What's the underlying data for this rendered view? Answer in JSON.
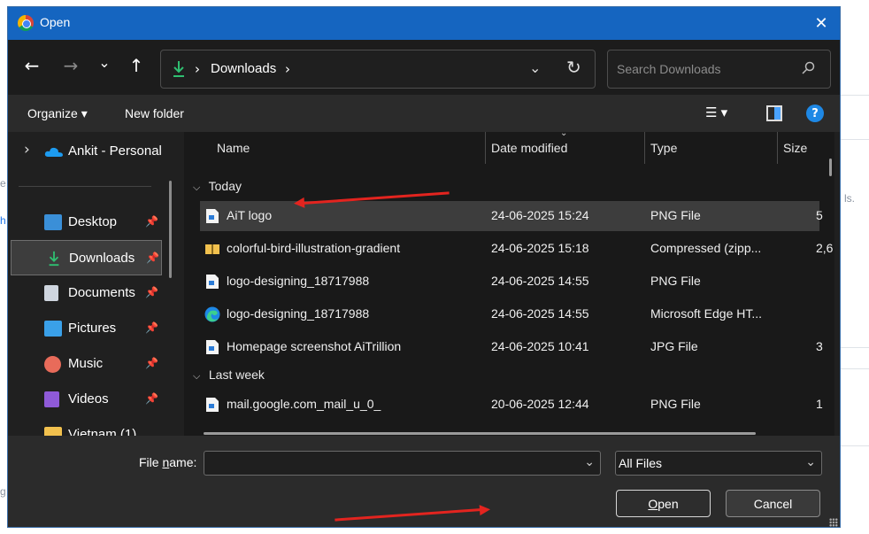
{
  "window": {
    "title": "Open",
    "close_glyph": "✕"
  },
  "background": {
    "frag_ds": "ls.",
    "frag_e": "e",
    "frag_h": "h",
    "frag_g": "g"
  },
  "nav": {
    "back_glyph": "←",
    "forward_glyph": "→",
    "recent_glyph": "⌄",
    "up_glyph": "↑",
    "separator_glyph": "›",
    "address": {
      "crumb": "Downloads",
      "dropdown_glyph": "⌄",
      "refresh_glyph": "↻"
    },
    "search_placeholder": "Search Downloads"
  },
  "toolbar": {
    "organize_label": "Organize ▾",
    "new_folder_label": "New folder",
    "view_glyph": "☰ ▾",
    "help_glyph": "?"
  },
  "sidebar": {
    "top_item": {
      "label": "Ankit - Personal",
      "chevron": "›"
    },
    "items": [
      {
        "label": "Desktop",
        "pin": "📌",
        "color": "#3a8fd8"
      },
      {
        "label": "Downloads",
        "pin": "📌",
        "color": "#2fbf71"
      },
      {
        "label": "Documents",
        "pin": "📌",
        "color": "#cfd6df"
      },
      {
        "label": "Pictures",
        "pin": "📌",
        "color": "#3aa0e8"
      },
      {
        "label": "Music",
        "pin": "📌",
        "color": "#e86b5a"
      },
      {
        "label": "Videos",
        "pin": "📌",
        "color": "#8f5ad8"
      },
      {
        "label": "Vietnam (1)",
        "pin": "",
        "color": "#f2c14e"
      }
    ]
  },
  "columns": {
    "name": "Name",
    "date": "Date modified",
    "type": "Type",
    "size": "Size"
  },
  "groups": {
    "today": {
      "label": "Today",
      "chevron": "⌵"
    },
    "last_week": {
      "label": "Last week",
      "chevron": "⌵"
    }
  },
  "files": [
    {
      "name": "AiT logo",
      "date": "24-06-2025 15:24",
      "type": "PNG File",
      "size": "5",
      "icon": "png-file-icon"
    },
    {
      "name": "colorful-bird-illustration-gradient",
      "date": "24-06-2025 15:18",
      "type": "Compressed (zipp...",
      "size": "2,6",
      "icon": "zip-folder-icon"
    },
    {
      "name": "logo-designing_18717988",
      "date": "24-06-2025 14:55",
      "type": "PNG File",
      "size": "",
      "icon": "png-file-icon"
    },
    {
      "name": "logo-designing_18717988",
      "date": "24-06-2025 14:55",
      "type": "Microsoft Edge HT...",
      "size": "",
      "icon": "edge-icon"
    },
    {
      "name": "Homepage screenshot AiTrillion",
      "date": "24-06-2025 10:41",
      "type": "JPG File",
      "size": "3",
      "icon": "jpg-file-icon"
    },
    {
      "name": "mail.google.com_mail_u_0_",
      "date": "20-06-2025 12:44",
      "type": "PNG File",
      "size": "1",
      "icon": "png-file-icon"
    }
  ],
  "footer": {
    "file_name_label": "File name:",
    "file_name_value": "",
    "file_type": "All Files",
    "dropdown_glyph": "⌄",
    "open_label": "Open",
    "cancel_label": "Cancel"
  }
}
